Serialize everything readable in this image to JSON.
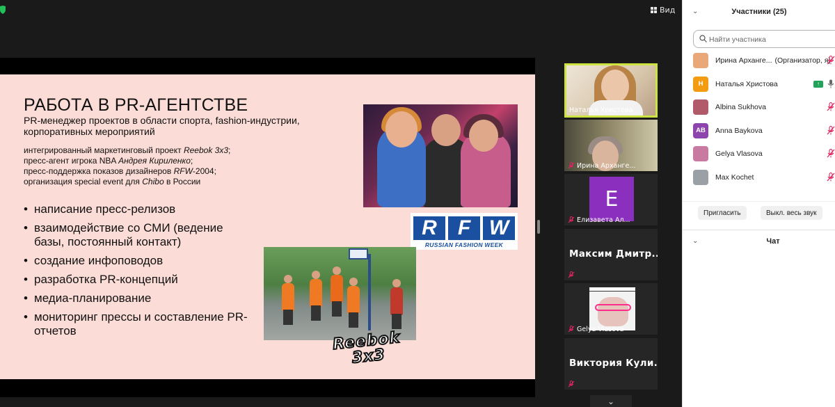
{
  "toolbar": {
    "view_label": "Вид"
  },
  "slide": {
    "title": "РАБОТА В PR-АГЕНТСТВЕ",
    "subtitle": "PR-менеджер проектов в области спорта, fashion-индустрии, корпоративных мероприятий",
    "projects": [
      {
        "pre": "интегрированный маркетинговый проект ",
        "em": "Reebok 3x3",
        "post": ";"
      },
      {
        "pre": "пресс-агент игрока NBA ",
        "em": "Андрея Кириленко",
        "post": ";"
      },
      {
        "pre": "пресс-поддержка показов дизайнеров ",
        "em": "RFW",
        "post": "-2004;"
      },
      {
        "pre": "организация special event для ",
        "em": "Chibo",
        "post": " в России"
      }
    ],
    "bullets": [
      "написание пресс-релизов",
      "взаимодействие со СМИ (ведение базы, постоянный контакт)",
      "создание инфоповодов",
      "разработка PR-концепций",
      "медиа-планирование",
      "мониторинг прессы и составление PR-отчетов"
    ],
    "rfw_letters": [
      "R",
      "F",
      "W"
    ],
    "rfw_tagline": "RUSSIAN FASHION WEEK",
    "reebok_logo": [
      "Reebok",
      "3x3"
    ]
  },
  "video_tiles": [
    {
      "name": "Наталья Христова",
      "active_speaker": true,
      "muted": false
    },
    {
      "name": "Ирина Арханге...",
      "muted": true
    },
    {
      "name": "Елизавета Ал...",
      "avatar_letter": "E",
      "avatar_color": "#8b2fbf",
      "muted": true
    },
    {
      "big_name": "Максим Дмитр...",
      "muted": true
    },
    {
      "name": "Gelya Vlasova",
      "muted": true
    },
    {
      "big_name": "Виктория Кули...",
      "muted": true
    }
  ],
  "participants_panel": {
    "title": "Участники (25)",
    "search_placeholder": "Найти участника",
    "participants": [
      {
        "name": "Ирина Арханге...",
        "role": "(Организатор, я)",
        "avatar_color": "#e8a878",
        "mic": "muted"
      },
      {
        "name": "Наталья Христова",
        "avatar_letter": "Н",
        "avatar_color": "#f39c12",
        "mic": "on",
        "sharing": true
      },
      {
        "name": "Albina Sukhova",
        "avatar_color": "#b05a6a",
        "mic": "muted"
      },
      {
        "name": "Anna Baykova",
        "avatar_letter": "AB",
        "avatar_color": "#8e44ad",
        "mic": "muted"
      },
      {
        "name": "Gelya Vlasova",
        "avatar_color": "#c97aa0",
        "mic": "muted"
      },
      {
        "name": "Max Kochet",
        "avatar_color": "#9aa0a6",
        "mic": "muted"
      }
    ],
    "invite_label": "Пригласить",
    "mute_all_label": "Выкл. весь звук",
    "chat_title": "Чат"
  },
  "colors": {
    "active_speaker_border": "#cde33f",
    "muted_mic": "#e0245e",
    "slide_background": "#fbdcd6",
    "rfw_blue": "#1b4fa0"
  }
}
